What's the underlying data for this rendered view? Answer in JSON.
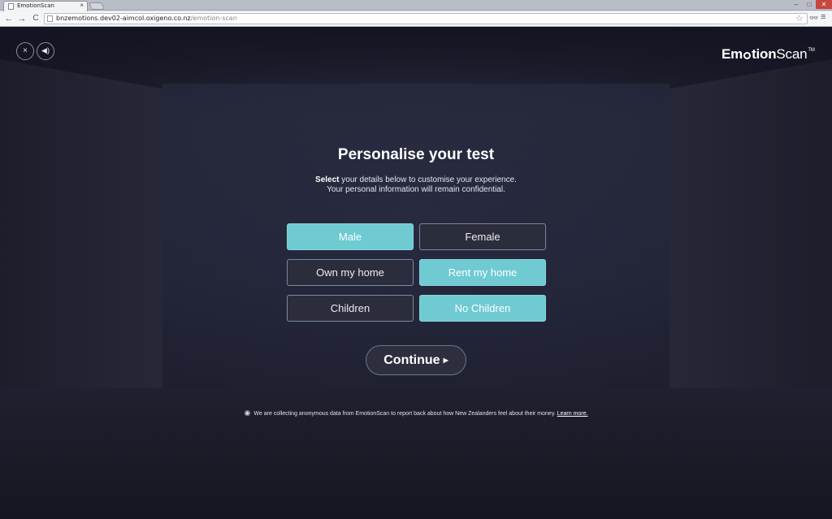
{
  "browser": {
    "tab_title": "EmotionScan",
    "tab_close": "×",
    "window_min": "–",
    "window_max": "□",
    "window_close": "✕",
    "nav_back": "←",
    "nav_forward": "→",
    "nav_reload": "C",
    "url_host": "bnzemotions.dev02-aimcol.oxigeno.co.nz",
    "url_path": "/emotion-scan",
    "star": "☆",
    "extension_icon": "👓",
    "menu": "≡"
  },
  "controls": {
    "close_label": "×",
    "sound_label": "◀)"
  },
  "logo": {
    "part1": "Em",
    "part2": "tion",
    "part3": "Scan",
    "tm": "TM"
  },
  "heading": {
    "title": "Personalise your test",
    "subtitle_bold": "Select",
    "subtitle_rest": " your details below to customise your experience.",
    "subtitle_line2": "Your personal information will remain confidential."
  },
  "options": {
    "male": "Male",
    "female": "Female",
    "own_home": "Own my home",
    "rent_home": "Rent my home",
    "children": "Children",
    "no_children": "No Children"
  },
  "continue": {
    "label": "Continue",
    "arrow": "▶"
  },
  "disclaimer": {
    "text": "We are collecting anonymous data from EmotionScan to report back about how New Zealanders feel about their money.",
    "link": "Learn more."
  },
  "colors": {
    "selected": "#6fcad2",
    "unselected": "#2b2d3c",
    "background": "#242638"
  },
  "state": {
    "gender": "Male",
    "home": "Rent my home",
    "children": "No Children"
  }
}
